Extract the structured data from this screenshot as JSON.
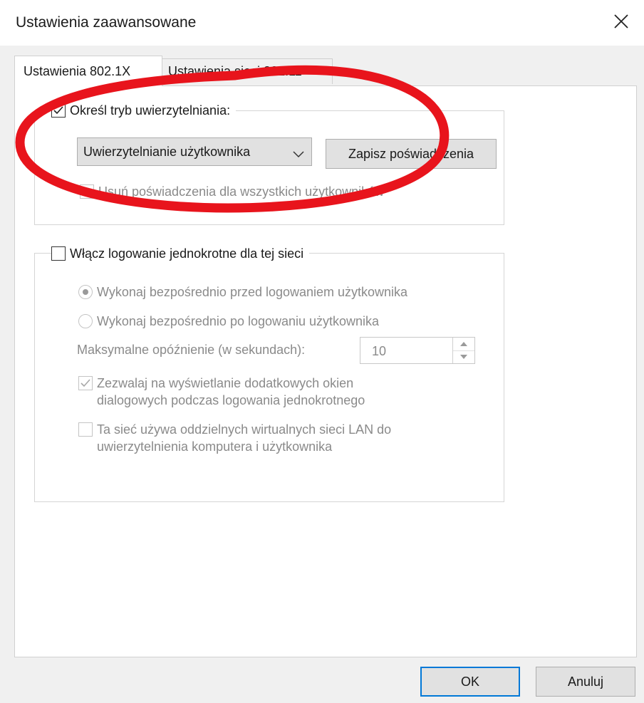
{
  "window": {
    "title": "Ustawienia zaawansowane",
    "close_glyph": "✕"
  },
  "tabs": [
    {
      "label": "Ustawienia 802.1X",
      "active": true
    },
    {
      "label": "Ustawienia sieci 802.11",
      "active": false
    }
  ],
  "auth_group": {
    "checkbox_label": "Określ tryb uwierzytelniania:",
    "checked": true,
    "mode_selected": "Uwierzytelnianie użytkownika",
    "save_button": "Zapisz poświadczenia",
    "delete_label": "Usuń poświadczenia dla wszystkich użytkowników",
    "delete_checked": false
  },
  "sso_group": {
    "checkbox_label": "Włącz logowanie jednokrotne dla tej sieci",
    "checked": false,
    "radio_before": "Wykonaj bezpośrednio przed logowaniem użytkownika",
    "radio_after": "Wykonaj bezpośrednio po logowaniu użytkownika",
    "delay_label": "Maksymalne opóźnienie (w sekundach):",
    "delay_value": "10",
    "allow_dialogs_line1": "Zezwalaj na wyświetlanie dodatkowych okien",
    "allow_dialogs_line2": "dialogowych podczas logowania jednokrotnego",
    "allow_dialogs_checked": true,
    "vlan_line1": "Ta sieć używa oddzielnych wirtualnych sieci LAN do",
    "vlan_line2": "uwierzytelnienia komputera i użytkownika",
    "vlan_checked": false
  },
  "footer": {
    "ok_label": "OK",
    "cancel_label": "Anuluj"
  },
  "colors": {
    "annotation_ellipse": "#e8141c",
    "default_button_border": "#0078d7"
  }
}
